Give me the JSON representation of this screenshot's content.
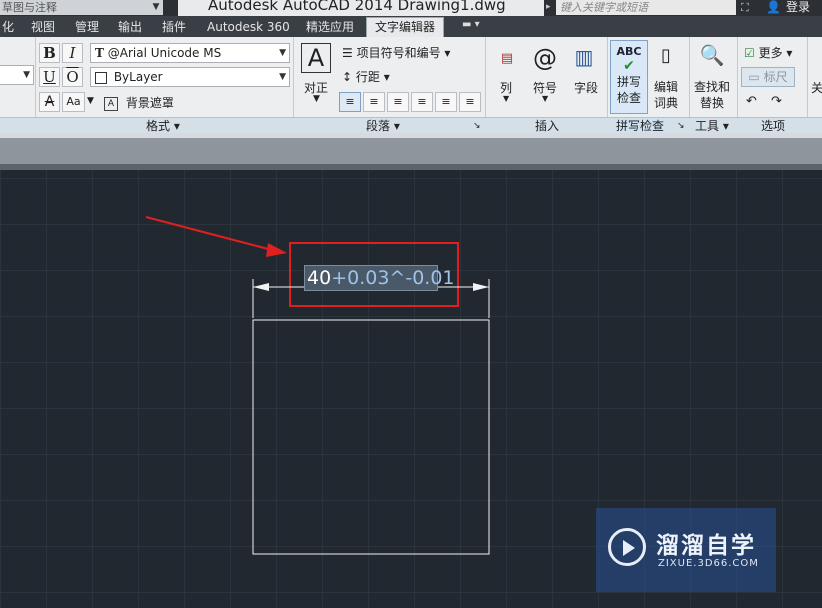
{
  "titlebar": {
    "workspace": "草图与注释",
    "app_title": "Autodesk AutoCAD 2014    Drawing1.dwg",
    "search_placeholder": "键入关键字或短语",
    "login": "登录"
  },
  "menu": {
    "tabs": [
      "化",
      "视图",
      "管理",
      "输出",
      "插件",
      "Autodesk 360",
      "精选应用",
      "文字编辑器"
    ],
    "active_tab": "文字编辑器"
  },
  "ribbon": {
    "format": {
      "bold": "B",
      "italic": "I",
      "underline": "U",
      "overline": "O",
      "font": "@Arial Unicode MS",
      "color": "ByLayer",
      "strike": "A",
      "case": "Aa",
      "background_mask": "背景遮罩",
      "label": "格式"
    },
    "paragraph": {
      "justify": "对正",
      "bullets": "项目符号和编号",
      "line_spacing": "行距",
      "label": "段落"
    },
    "insert": {
      "columns": "列",
      "symbol": "符号",
      "field": "字段",
      "label": "插入"
    },
    "spellcheck": {
      "spell_icon_text": "ABC",
      "spell": "拼写\n检查",
      "edit_dict": "编辑\n词典",
      "label": "拼写检查"
    },
    "tools": {
      "find_replace": "查找和\n替换",
      "label": "工具"
    },
    "options": {
      "more": "更多",
      "ruler": "标尺",
      "label": "选项"
    },
    "close": "关"
  },
  "drawing": {
    "dimension_base": "40",
    "dimension_tolerance": "+0.03^-0.01",
    "colors": {
      "annotation": "#e02020",
      "geometry": "#f2f2f2",
      "canvas": "#212830"
    }
  },
  "watermark": {
    "title": "溜溜自学",
    "url": "ZIXUE.3D66.COM"
  }
}
